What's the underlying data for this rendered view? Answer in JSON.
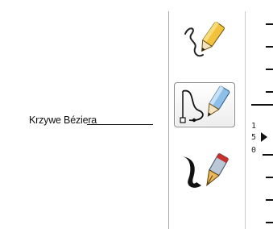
{
  "callout": {
    "label": "Krzywe Béziera"
  },
  "toolbox": {
    "tools": [
      {
        "icon": "freehand-pencil-icon",
        "selected": false
      },
      {
        "icon": "bezier-curve-tool-icon",
        "selected": true
      },
      {
        "icon": "calligraphy-pen-icon",
        "selected": false
      }
    ]
  },
  "ruler": {
    "labels": [
      "1",
      "5",
      "0"
    ]
  }
}
